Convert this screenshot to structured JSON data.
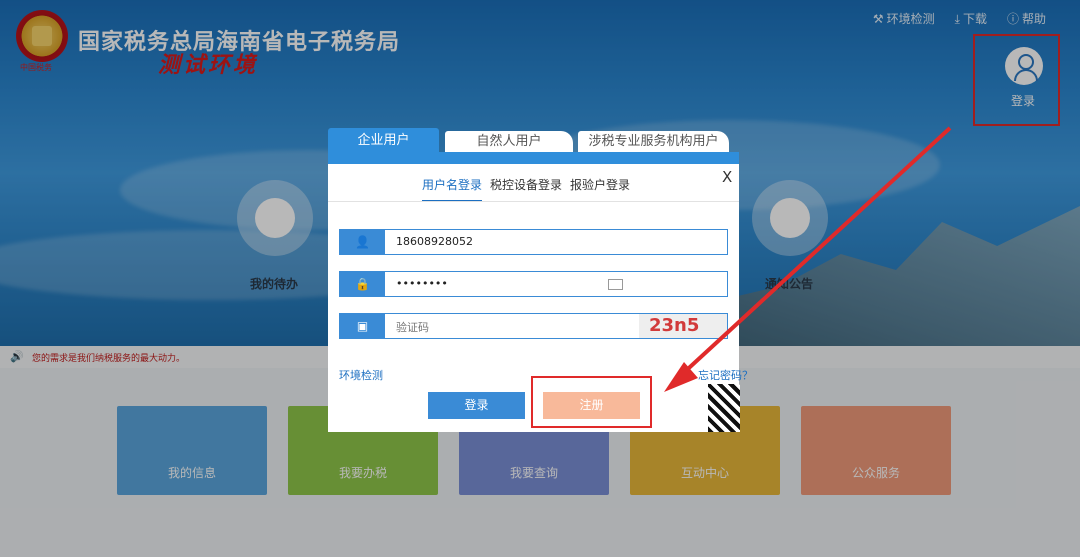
{
  "header": {
    "site_title": "国家税务总局海南省电子税务局",
    "test_env": "测试环境",
    "emblem_caption": "中国税务",
    "top_links": [
      {
        "label": "环境检测",
        "icon": "wrench-icon"
      },
      {
        "label": "下载",
        "icon": "download-icon"
      },
      {
        "label": "帮助",
        "icon": "help-icon"
      }
    ],
    "login_label": "登录"
  },
  "quick_circles": [
    {
      "label": "我的待办",
      "icon": "document-icon"
    },
    {
      "label": "通知公告",
      "icon": "bell-icon"
    }
  ],
  "ticker": {
    "text": "您的需求是我们纳税服务的最大动力。"
  },
  "tiles": [
    {
      "label": "我的信息",
      "color": "#5aa6dd",
      "icon": "user-icon"
    },
    {
      "label": "我要办税",
      "color": "#8fc64a",
      "icon": "monitor-icon"
    },
    {
      "label": "我要查询",
      "color": "#7b8fd6",
      "icon": "search-doc-icon"
    },
    {
      "label": "互动中心",
      "color": "#e8b83a",
      "icon": "chat-icon"
    },
    {
      "label": "公众服务",
      "color": "#f09a7a",
      "icon": "graduate-icon"
    }
  ],
  "modal": {
    "tabs": [
      "企业用户",
      "自然人用户",
      "涉税专业服务机构用户"
    ],
    "subtabs": [
      "用户名登录",
      "税控设备登录",
      "报验户登录"
    ],
    "close": "X",
    "username": "18608928052",
    "password": "••••••••",
    "captcha_placeholder": "验证码",
    "captcha_code": "23n5",
    "env_check": "环境检测",
    "forgot": "忘记密码？",
    "login_btn": "登录",
    "register_btn": "注册"
  },
  "colors": {
    "primary": "#2f8edb",
    "annotation": "#e02a2a",
    "register": "#f8b99a"
  }
}
